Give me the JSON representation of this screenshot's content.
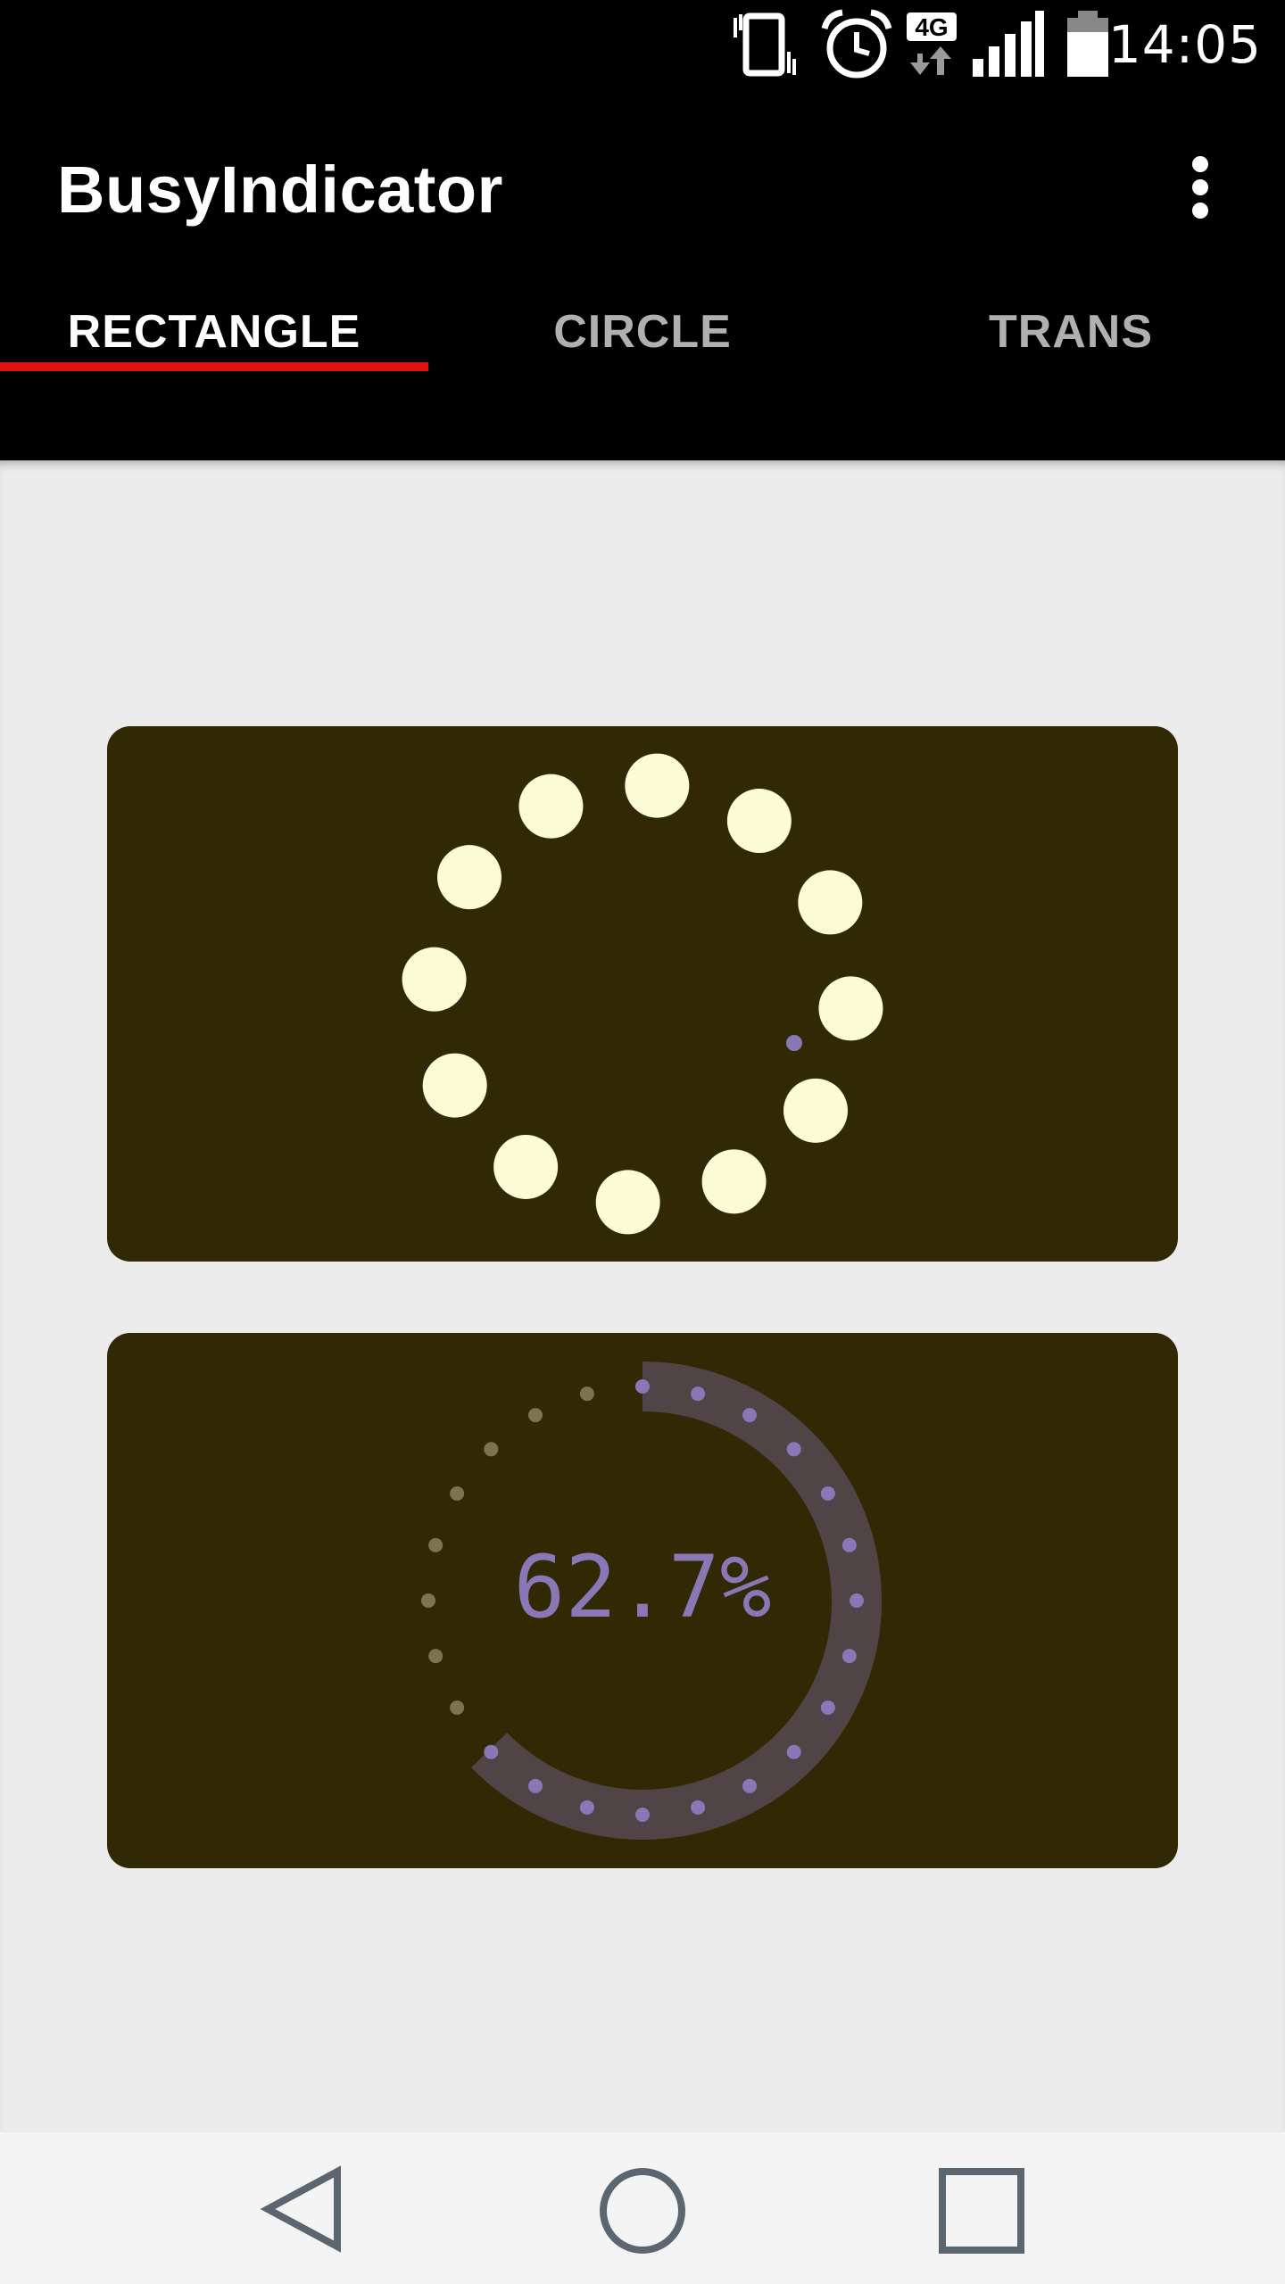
{
  "status_bar": {
    "time": "14:05",
    "network": "4G",
    "icons": [
      "vibrate-icon",
      "alarm-icon",
      "network-4g-icon",
      "signal-icon",
      "battery-icon"
    ]
  },
  "app_bar": {
    "title": "BusyIndicator",
    "menu_icon": "more-vert-icon"
  },
  "tabs": [
    {
      "label": "RECTANGLE",
      "active": true
    },
    {
      "label": "CIRCLE",
      "active": false
    },
    {
      "label": "TRANS",
      "active": false
    }
  ],
  "indicators": {
    "dots_indicator": {
      "dot_count": 12,
      "dot_color": "#fbfcd4",
      "accent_dot_color": "#8a77b5"
    },
    "progress_indicator": {
      "progress": 0.627,
      "label": "62.7%",
      "arc_color": "#504447",
      "active_dot_color": "#8a77b5",
      "inactive_dot_color": "#7b744e"
    },
    "card_color": "#302904"
  },
  "nav_bar": {
    "icons": [
      "back-icon",
      "home-icon",
      "recents-icon"
    ]
  },
  "colors": {
    "accent": "#e01010",
    "background": "#ececec"
  }
}
